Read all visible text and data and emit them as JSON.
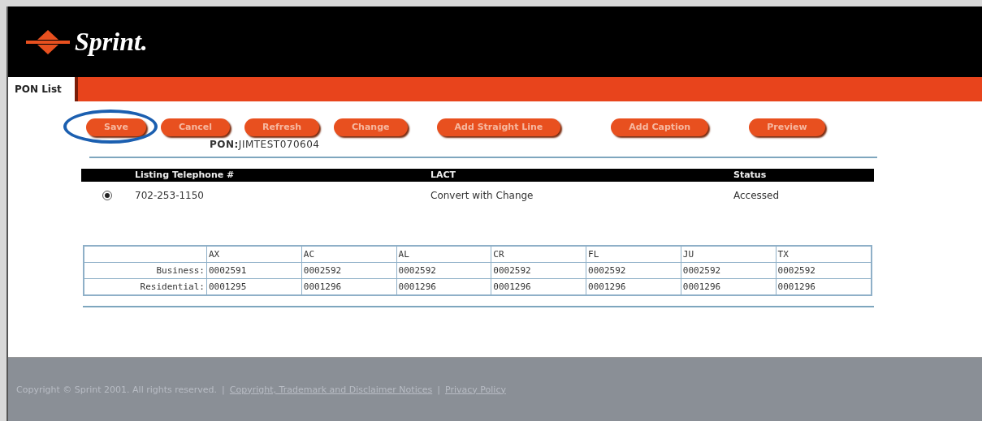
{
  "brand": {
    "name": "Sprint."
  },
  "tabs": [
    {
      "label": "PON List",
      "selected": true
    }
  ],
  "buttons": [
    {
      "label": "Save",
      "highlighted": true
    },
    {
      "label": "Cancel",
      "highlighted": false
    },
    {
      "label": "Refresh",
      "highlighted": false
    },
    {
      "label": "Change",
      "highlighted": false
    },
    {
      "label": "Add Straight Line",
      "highlighted": false
    },
    {
      "label": "Add Caption",
      "highlighted": false
    },
    {
      "label": "Preview",
      "highlighted": false
    }
  ],
  "pon": {
    "label": "PON:",
    "value": "JIMTEST070604"
  },
  "listing": {
    "columns": [
      "Listing Telephone #",
      "LACT",
      "Status"
    ],
    "rows": [
      {
        "selected": true,
        "cells": [
          "702-253-1150",
          "Convert with Change",
          "Accessed"
        ]
      }
    ]
  },
  "grid": {
    "columns": [
      "AX",
      "AC",
      "AL",
      "CR",
      "FL",
      "JU",
      "TX"
    ],
    "rows": [
      {
        "label": "Business:",
        "cells": [
          "0002591",
          "0002592",
          "0002592",
          "0002592",
          "0002592",
          "0002592",
          "0002592"
        ]
      },
      {
        "label": "Residential:",
        "cells": [
          "0001295",
          "0001296",
          "0001296",
          "0001296",
          "0001296",
          "0001296",
          "0001296"
        ]
      }
    ]
  },
  "footer": {
    "copyright": "Copyright © Sprint 2001. All rights reserved.",
    "separator": "|",
    "links": [
      "Copyright, Trademark and Disclaimer Notices",
      "Privacy Policy"
    ]
  }
}
